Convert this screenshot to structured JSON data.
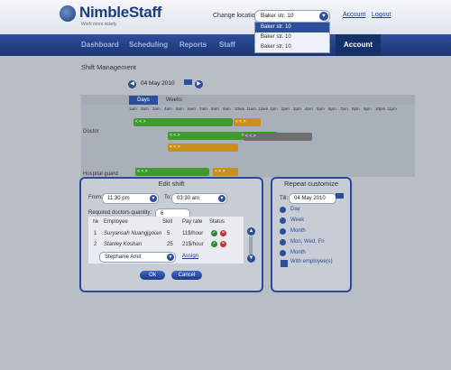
{
  "header": {
    "logo": "NimbleStaff",
    "tagline": "Work more wisely",
    "change_location_label": "Change location:",
    "location_value": "Baker str. 10",
    "account": "Account",
    "logout": "Logout"
  },
  "location_options": [
    "Baker str. 10",
    "Baker str. 10",
    "Baker str. 10"
  ],
  "nav": {
    "items": [
      "Dashboard",
      "Scheduling",
      "Reports",
      "Staff",
      "Account"
    ]
  },
  "page": {
    "title": "Shift Management",
    "date": "04 May 2010",
    "tabs": [
      "Days",
      "Weeks"
    ],
    "rows": [
      "Doctor",
      "Hospital guard"
    ],
    "time_headers": [
      "1am",
      "2am",
      "3am",
      "4am",
      "5am",
      "6am",
      "7am",
      "8am",
      "9am",
      "10am",
      "11am",
      "12am",
      "1pm",
      "2pm",
      "3pm",
      "4pm",
      "5pm",
      "6pm",
      "7pm",
      "8pm",
      "9pm",
      "10pm",
      "11pm"
    ],
    "bar_icons": "< < >"
  },
  "edit_shift": {
    "title": "Edit shift",
    "from_label": "From:",
    "from_value": "11:30 pm",
    "to_label": "To:",
    "to_value": "03:30 am",
    "required_label": "Required doctors quantity:",
    "required_value": "6",
    "columns": [
      "№",
      "Employee",
      "Skill",
      "Pay rate",
      "Status"
    ],
    "rows": [
      {
        "num": "1",
        "name": "Suryansah Nuangjgoian",
        "skill": "5",
        "rate": "11$/hour"
      },
      {
        "num": "2",
        "name": "Stanley Koshan",
        "skill": "25",
        "rate": "21$/hour"
      }
    ],
    "new_employee": "Stephanie Amit",
    "assign": "Assign",
    "ok": "Ok",
    "cancel": "Cancel"
  },
  "repeat": {
    "title": "Repeat customize",
    "till_label": "Till:",
    "till_value": "04 May 2010",
    "options": [
      "Day",
      "Week",
      "Month",
      "Mon, Wed, Fri",
      "Month"
    ],
    "with_employees": "With employee(s)"
  }
}
